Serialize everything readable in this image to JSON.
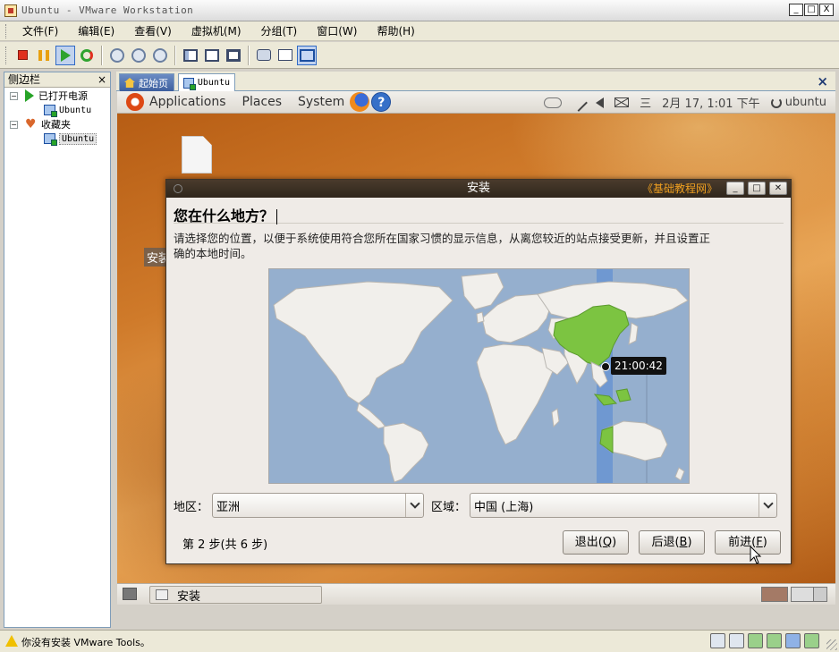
{
  "window": {
    "title": "Ubuntu - VMware Workstation",
    "controls": [
      "_",
      "□",
      "X"
    ]
  },
  "menubar": [
    {
      "label": "文件(F)"
    },
    {
      "label": "编辑(E)"
    },
    {
      "label": "查看(V)"
    },
    {
      "label": "虚拟机(M)"
    },
    {
      "label": "分组(T)"
    },
    {
      "label": "窗口(W)"
    },
    {
      "label": "帮助(H)"
    }
  ],
  "toolbar": {
    "icons": [
      "stop-icon",
      "pause-icon",
      "play-icon",
      "reset-icon",
      "snapshot-icon",
      "revert-snapshot-icon",
      "snapshot-manager-icon",
      "sidebar-view-icon",
      "quick-switch-icon",
      "fullscreen-icon",
      "capture-icon",
      "console-icon",
      "summary-icon"
    ]
  },
  "sidebar": {
    "title": "侧边栏",
    "close": "×",
    "groups": [
      {
        "expander": "−",
        "label": "已打开电源",
        "items": [
          "Ubuntu"
        ]
      },
      {
        "expander": "−",
        "label": "收藏夹",
        "items": [
          "Ubuntu"
        ]
      }
    ]
  },
  "tabs": [
    {
      "label": "起始页"
    },
    {
      "label": "Ubuntu"
    }
  ],
  "tab_close": "×",
  "guest": {
    "panel": {
      "menus": [
        "Applications",
        "Places",
        "System"
      ],
      "weekday": "三",
      "datetime": "2月 17, 1:01 下午",
      "user": "ubuntu"
    },
    "desktop_label": "安装",
    "dialog": {
      "title": "安装",
      "watermark": "《基础教程网》",
      "heading": "您在什么地方？",
      "description": "请选择您的位置，以便于系统使用符合您所在国家习惯的显示信息，从离您较近的站点接受更新，并且设置正确的本地时间。",
      "time_label": "21:00:42",
      "region_label": "地区：",
      "region_value": "亚洲",
      "zone_label": "区域：",
      "zone_value": "中国 (上海)",
      "step": "第 2 步(共 6 步)",
      "buttons": {
        "quit": {
          "label": "退出(",
          "key": "Q",
          "tail": ")"
        },
        "back": {
          "label": "后退(",
          "key": "B",
          "tail": ")"
        },
        "forward": {
          "label": "前进(",
          "key": "F",
          "tail": ")"
        }
      }
    },
    "taskbar": {
      "task_label": "安装"
    }
  },
  "statusbar": {
    "message": "你没有安装 VMware Tools。"
  }
}
